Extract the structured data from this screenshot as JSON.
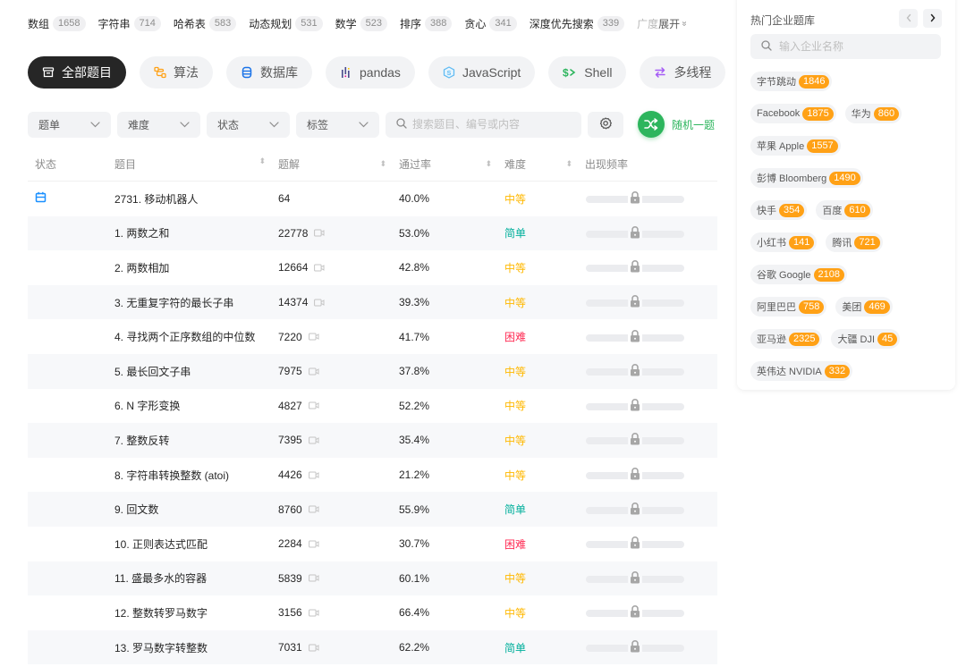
{
  "topic_tags": [
    {
      "label": "数组",
      "count": "1658"
    },
    {
      "label": "字符串",
      "count": "714"
    },
    {
      "label": "哈希表",
      "count": "583"
    },
    {
      "label": "动态规划",
      "count": "531"
    },
    {
      "label": "数学",
      "count": "523"
    },
    {
      "label": "排序",
      "count": "388"
    },
    {
      "label": "贪心",
      "count": "341"
    },
    {
      "label": "深度优先搜索",
      "count": "339"
    }
  ],
  "topic_more": {
    "faded": "广度",
    "label": "展开"
  },
  "categories": [
    {
      "label": "全部题目",
      "icon": "layers-icon",
      "active": true
    },
    {
      "label": "算法",
      "icon": "algorithm-icon"
    },
    {
      "label": "数据库",
      "icon": "database-icon"
    },
    {
      "label": "pandas",
      "icon": "pandas-icon"
    },
    {
      "label": "JavaScript",
      "icon": "javascript-icon"
    },
    {
      "label": "Shell",
      "icon": "shell-icon"
    },
    {
      "label": "多线程",
      "icon": "concurrency-icon"
    }
  ],
  "filters": {
    "selects": [
      {
        "label": "题单"
      },
      {
        "label": "难度"
      },
      {
        "label": "状态"
      },
      {
        "label": "标签"
      }
    ],
    "search_placeholder": "搜索题目、编号或内容",
    "search_value": "",
    "random_label": "随机一题"
  },
  "table": {
    "headers": {
      "status": "状态",
      "title": "题目",
      "solutions": "题解",
      "pass_rate": "通过率",
      "difficulty": "难度",
      "frequency": "出现频率"
    },
    "rows": [
      {
        "status_icon": "calendar-icon",
        "title": "2731. 移动机器人",
        "solutions": "64",
        "video": false,
        "pass_rate": "40.0%",
        "difficulty": "中等",
        "level": "medium"
      },
      {
        "title": "1. 两数之和",
        "solutions": "22778",
        "video": true,
        "pass_rate": "53.0%",
        "difficulty": "简单",
        "level": "easy"
      },
      {
        "title": "2. 两数相加",
        "solutions": "12664",
        "video": true,
        "pass_rate": "42.8%",
        "difficulty": "中等",
        "level": "medium"
      },
      {
        "title": "3. 无重复字符的最长子串",
        "solutions": "14374",
        "video": true,
        "pass_rate": "39.3%",
        "difficulty": "中等",
        "level": "medium"
      },
      {
        "title": "4. 寻找两个正序数组的中位数",
        "solutions": "7220",
        "video": true,
        "pass_rate": "41.7%",
        "difficulty": "困难",
        "level": "hard"
      },
      {
        "title": "5. 最长回文子串",
        "solutions": "7975",
        "video": true,
        "pass_rate": "37.8%",
        "difficulty": "中等",
        "level": "medium"
      },
      {
        "title": "6. N 字形变换",
        "solutions": "4827",
        "video": true,
        "pass_rate": "52.2%",
        "difficulty": "中等",
        "level": "medium"
      },
      {
        "title": "7. 整数反转",
        "solutions": "7395",
        "video": true,
        "pass_rate": "35.4%",
        "difficulty": "中等",
        "level": "medium"
      },
      {
        "title": "8. 字符串转换整数 (atoi)",
        "solutions": "4426",
        "video": true,
        "pass_rate": "21.2%",
        "difficulty": "中等",
        "level": "medium"
      },
      {
        "title": "9. 回文数",
        "solutions": "8760",
        "video": true,
        "pass_rate": "55.9%",
        "difficulty": "简单",
        "level": "easy"
      },
      {
        "title": "10. 正则表达式匹配",
        "solutions": "2284",
        "video": true,
        "pass_rate": "30.7%",
        "difficulty": "困难",
        "level": "hard"
      },
      {
        "title": "11. 盛最多水的容器",
        "solutions": "5839",
        "video": true,
        "pass_rate": "60.1%",
        "difficulty": "中等",
        "level": "medium"
      },
      {
        "title": "12. 整数转罗马数字",
        "solutions": "3156",
        "video": true,
        "pass_rate": "66.4%",
        "difficulty": "中等",
        "level": "medium"
      },
      {
        "title": "13. 罗马数字转整数",
        "solutions": "7031",
        "video": true,
        "pass_rate": "62.2%",
        "difficulty": "简单",
        "level": "easy"
      }
    ]
  },
  "company_panel": {
    "title": "热门企业题库",
    "search_placeholder": "输入企业名称",
    "companies": [
      {
        "name": "字节跳动",
        "count": "1846",
        "break_after": true
      },
      {
        "name": "Facebook",
        "count": "1875"
      },
      {
        "name": "华为",
        "count": "860",
        "break_after": true
      },
      {
        "name": "苹果 Apple",
        "count": "1557",
        "break_after": true
      },
      {
        "name": "彭博 Bloomberg",
        "count": "1490",
        "break_after": true
      },
      {
        "name": "快手",
        "count": "354"
      },
      {
        "name": "百度",
        "count": "610",
        "break_after": true
      },
      {
        "name": "小红书",
        "count": "141"
      },
      {
        "name": "腾讯",
        "count": "721",
        "break_after": true
      },
      {
        "name": "谷歌 Google",
        "count": "2108",
        "break_after": true
      },
      {
        "name": "阿里巴巴",
        "count": "758"
      },
      {
        "name": "美团",
        "count": "469",
        "break_after": true
      },
      {
        "name": "亚马逊",
        "count": "2325"
      },
      {
        "name": "大疆 DJI",
        "count": "45",
        "break_after": true
      },
      {
        "name": "英伟达 NVIDIA",
        "count": "332"
      }
    ]
  },
  "colors": {
    "easy": "#00af9b",
    "medium": "#ffb800",
    "hard": "#ff2d55",
    "accent_orange": "#ffa116",
    "random_green": "#2db55d"
  }
}
